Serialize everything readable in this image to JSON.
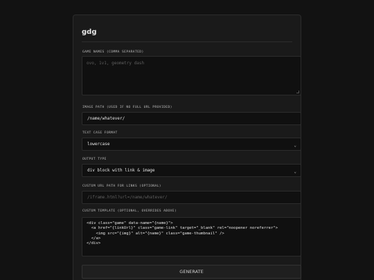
{
  "title": "gdg",
  "fields": {
    "game_names": {
      "label": "GAME NAMES (COMMA SEPARATED)",
      "placeholder": "ovo, 1v1, geometry dash"
    },
    "image_path": {
      "label": "IMAGE PATH (USED IF NO FULL URL PROVIDED)",
      "value": "/name/whatever/"
    },
    "text_case": {
      "label": "TEXT CASE FORMAT",
      "selected": "lowercase"
    },
    "output_type": {
      "label": "OUTPUT TYPE",
      "selected": "div block with link & image"
    },
    "custom_url": {
      "label": "CUSTOM URL PATH FOR LINKS (OPTIONAL)",
      "placeholder": "/iframe.html?url=/name/whatever/"
    },
    "custom_template": {
      "label": "CUSTOM TEMPLATE (OPTIONAL, OVERRIDES ABOVE)",
      "value": "<div class=\"game\" data-name=\"{name}\">\n  <a href=\"{linkUrl}\" class=\"game-link\" target=\"_blank\" rel=\"noopener noreferrer\">\n    <img src=\"{img}\" alt=\"{name}\" class=\"game-thumbnail\" />\n  </a>\n</div>"
    }
  },
  "generate_label": "GENERATE",
  "icons": {
    "dropdown": "chevron-down-icon"
  }
}
